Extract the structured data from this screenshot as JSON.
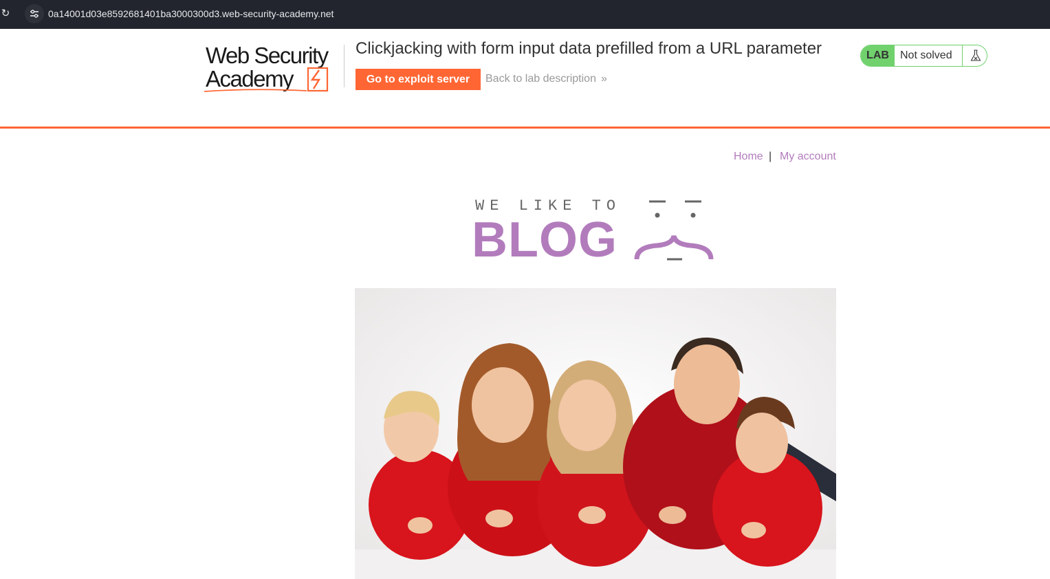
{
  "browser": {
    "url": "0a14001d03e8592681401ba3000300d3.web-security-academy.net"
  },
  "lab_header": {
    "logo_line1": "Web Security",
    "logo_line2": "Academy",
    "title": "Clickjacking with form input data prefilled from a URL parameter",
    "exploit_button": "Go to exploit server",
    "back_link": "Back to lab description",
    "status_badge": "LAB",
    "status_text": "Not solved"
  },
  "nav": {
    "home": "Home",
    "separator": "|",
    "my_account": "My account"
  },
  "banner": {
    "line1": "WE LIKE TO",
    "line2": "BLOG"
  },
  "colors": {
    "accent": "#ff6633",
    "link": "#b27cbc",
    "lab_green": "#70d16d",
    "browser_bar": "#22252d"
  }
}
